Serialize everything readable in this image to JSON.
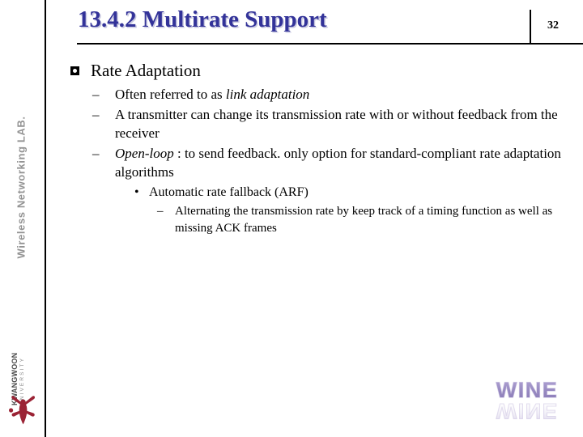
{
  "header": {
    "title": "13.4.2 Multirate Support",
    "page_number": "32",
    "title_color": "#333399"
  },
  "sidebar": {
    "lab_label": "Wireless Networking LAB.",
    "lab_label_color": "#939393",
    "university": {
      "name": "KWANGWOON",
      "subtitle": "UNIVERSITY",
      "mark_color": "#9b2335",
      "mark_icon": "kwangwoon-figure-icon"
    }
  },
  "content": {
    "level1": {
      "bullet_icon": "square-dot-bullet-icon",
      "text": "Rate Adaptation"
    },
    "items": [
      {
        "level": 2,
        "marker": "–",
        "pre": "Often referred to as ",
        "italic": "link adaptation",
        "post": ""
      },
      {
        "level": 2,
        "marker": "–",
        "pre": "A transmitter can change its transmission rate with or without feedback from the receiver",
        "italic": "",
        "post": ""
      },
      {
        "level": 2,
        "marker": "–",
        "pre": "",
        "italic": "Open-loop",
        "post": " : to send feedback. only option for standard-compliant rate adaptation algorithms"
      },
      {
        "level": 3,
        "marker": "•",
        "pre": "Automatic rate fallback (ARF)",
        "italic": "",
        "post": ""
      },
      {
        "level": 4,
        "marker": "–",
        "pre": "Alternating the transmission rate by keep track of a timing function as well as missing ACK frames",
        "italic": "",
        "post": ""
      }
    ]
  },
  "footer": {
    "wine_logo": {
      "text": "WINE",
      "color": "#9b8ec4",
      "reflection_text": "WINE"
    }
  }
}
